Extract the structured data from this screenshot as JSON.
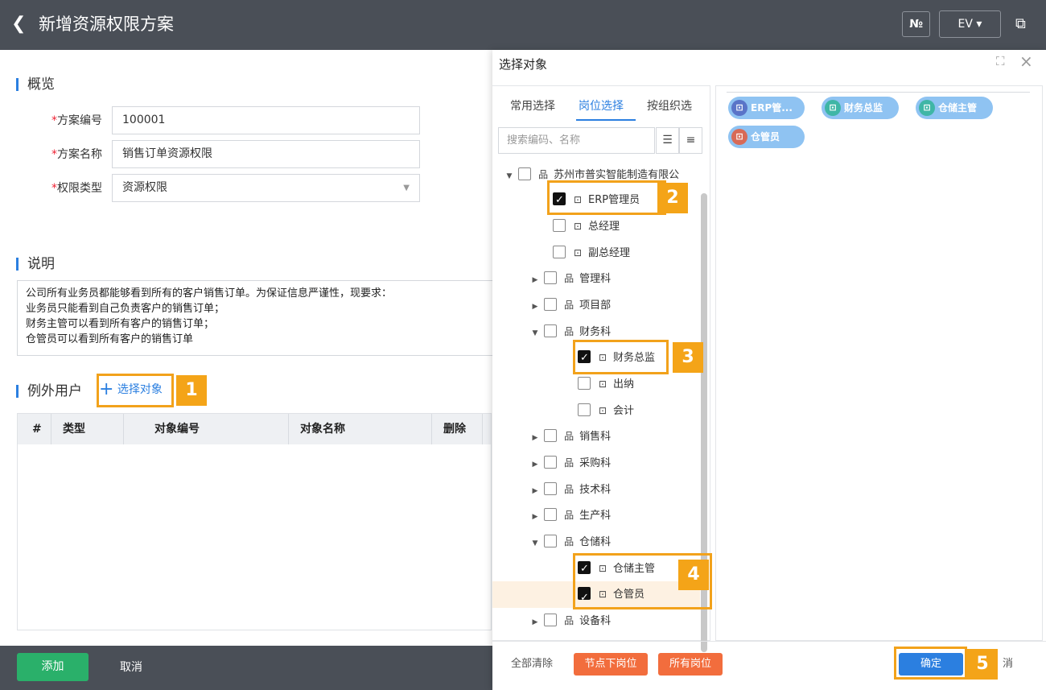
{
  "header": {
    "back_icon": "chevron-left-icon",
    "title": "新增资源权限方案",
    "no_button": "№",
    "env_label": "EV ▾",
    "export_icon": "external-link-icon"
  },
  "overview": {
    "title": "概览",
    "fields": [
      {
        "label": "方案编号",
        "value": "100001"
      },
      {
        "label": "方案名称",
        "value": "销售订单资源权限"
      },
      {
        "label": "权限类型",
        "value": "资源权限"
      }
    ]
  },
  "description": {
    "title": "说明",
    "lines": [
      "公司所有业务员都能够看到所有的客户销售订单。为保证信息严谨性，现要求：",
      "业务员只能看到自己负责客户的销售订单；",
      "财务主管可以看到所有客户的销售订单；",
      "仓管员可以看到所有客户的销售订单"
    ]
  },
  "exceptions": {
    "title": "例外用户",
    "select_label": "选择对象",
    "columns": [
      "#",
      "类型",
      "对象编号",
      "对象名称",
      "删除"
    ]
  },
  "footer": {
    "add": "添加",
    "cancel": "取消"
  },
  "modal": {
    "title": "选择对象",
    "tabs": [
      "常用选择",
      "岗位选择",
      "按组织选"
    ],
    "active_tab": "岗位选择",
    "search_placeholder": "搜索编码、名称",
    "tree": [
      {
        "label": "苏州市普实智能制造有限公",
        "type": "org",
        "expanded": true,
        "checked": false
      },
      {
        "label": "ERP管理员",
        "type": "post",
        "checked": true
      },
      {
        "label": "总经理",
        "type": "post",
        "checked": false
      },
      {
        "label": "副总经理",
        "type": "post",
        "checked": false
      },
      {
        "label": "管理科",
        "type": "org",
        "expanded": false,
        "checked": false
      },
      {
        "label": "项目部",
        "type": "org",
        "expanded": false,
        "checked": false
      },
      {
        "label": "财务科",
        "type": "org",
        "expanded": true,
        "checked": false
      },
      {
        "label": "财务总监",
        "type": "post",
        "checked": true
      },
      {
        "label": "出纳",
        "type": "post",
        "checked": false
      },
      {
        "label": "会计",
        "type": "post",
        "checked": false
      },
      {
        "label": "销售科",
        "type": "org",
        "expanded": false,
        "checked": false
      },
      {
        "label": "采购科",
        "type": "org",
        "expanded": false,
        "checked": false
      },
      {
        "label": "技术科",
        "type": "org",
        "expanded": false,
        "checked": false
      },
      {
        "label": "生产科",
        "type": "org",
        "expanded": false,
        "checked": false
      },
      {
        "label": "仓储科",
        "type": "org",
        "expanded": true,
        "checked": false
      },
      {
        "label": "仓储主管",
        "type": "post",
        "checked": true
      },
      {
        "label": "仓管员",
        "type": "post",
        "checked": true
      },
      {
        "label": "设备科",
        "type": "org",
        "expanded": false,
        "checked": false
      }
    ],
    "selected_chips": [
      {
        "label": "ERP管...",
        "color": "#8fc3f2",
        "icon_color": "#5a74c8"
      },
      {
        "label": "财务总监",
        "color": "#8fc3f2",
        "icon_color": "#3fb6a6"
      },
      {
        "label": "仓储主管",
        "color": "#8fc3f2",
        "icon_color": "#3fb6a6"
      },
      {
        "label": "仓管员",
        "color": "#8fc3f2",
        "icon_color": "#d86a57"
      }
    ],
    "footer": {
      "clear_all": "全部清除",
      "node_posts": "节点下岗位",
      "all_posts": "所有岗位",
      "confirm": "确定",
      "cancel_partial": "消"
    }
  },
  "annotations": [
    "1",
    "2",
    "3",
    "4",
    "5"
  ],
  "colors": {
    "accent": "#2b7fe0",
    "highlight": "#f2a21b",
    "header_bg": "#4a4f57",
    "add_green": "#2ab06a",
    "orange": "#f26d3d"
  }
}
